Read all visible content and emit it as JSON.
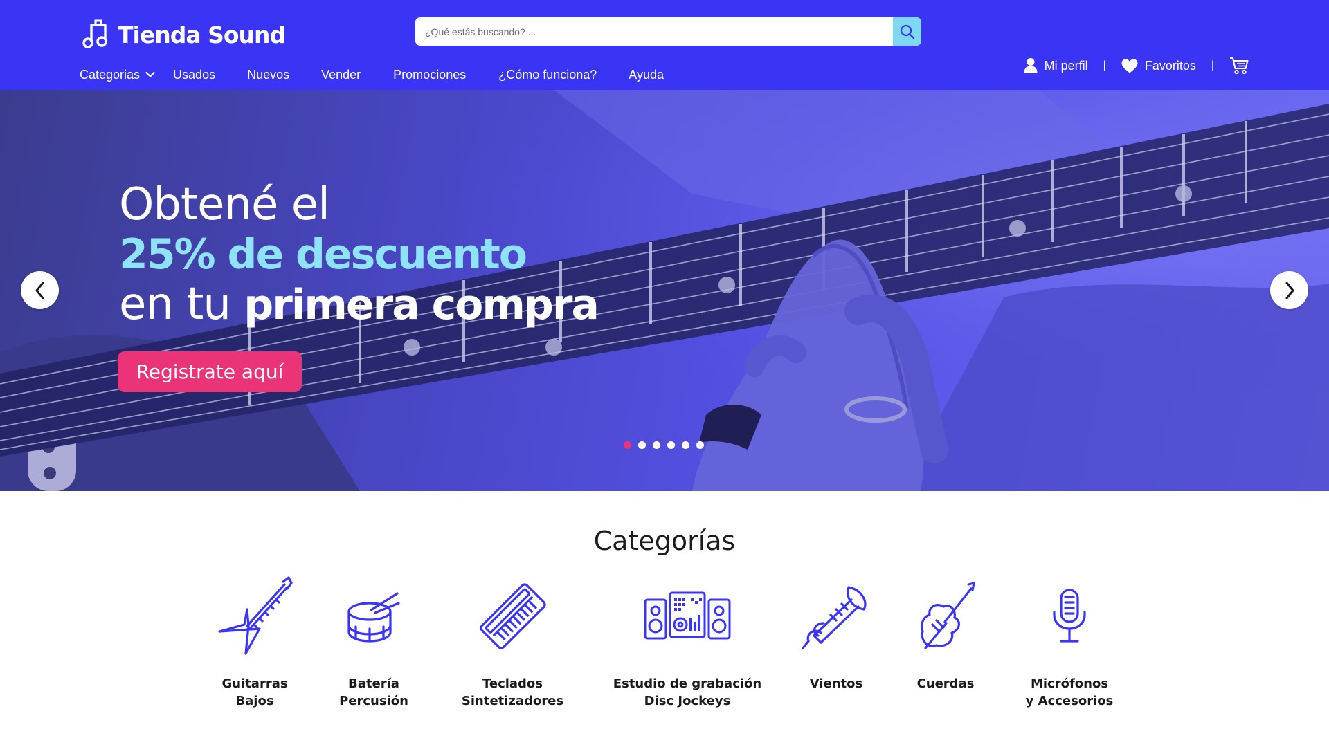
{
  "brand": {
    "name": "Tienda Sound",
    "logo_icon": "music-note-icon"
  },
  "search": {
    "placeholder": "¿Qué estás buscando? ...",
    "value": "",
    "icon": "search-icon"
  },
  "nav": {
    "items": [
      {
        "label": "Categorias",
        "has_dropdown": true
      },
      {
        "label": "Usados"
      },
      {
        "label": "Nuevos"
      },
      {
        "label": "Vender"
      },
      {
        "label": "Promociones"
      },
      {
        "label": "¿Cómo funciona?"
      },
      {
        "label": "Ayuda"
      }
    ]
  },
  "user_menu": {
    "profile_label": "Mi perfil",
    "favorites_label": "Favoritos",
    "separator": "|",
    "cart_icon": "shopping-cart-icon"
  },
  "hero": {
    "line1": "Obtené el",
    "line2": "25% de descuento",
    "line3_regular": "en tu ",
    "line3_bold": "primera compra",
    "cta_label": "Registrate aquí",
    "slides_total": 6,
    "active_slide": 1
  },
  "categories": {
    "title": "Categorías",
    "items": [
      {
        "line1": "Guitarras",
        "line2": "Bajos",
        "icon": "electric-guitar-icon"
      },
      {
        "line1": "Batería",
        "line2": "Percusión",
        "icon": "drum-icon"
      },
      {
        "line1": "Teclados",
        "line2": "Sintetizadores",
        "icon": "keyboard-synth-icon"
      },
      {
        "line1": "Estudio de grabación",
        "line2": "Disc Jockeys",
        "icon": "studio-speakers-icon"
      },
      {
        "line1": "Vientos",
        "line2": "",
        "icon": "trumpet-icon"
      },
      {
        "line1": "Cuerdas",
        "line2": "",
        "icon": "violin-icon"
      },
      {
        "line1": "Micrófonos",
        "line2": "y Accesorios",
        "icon": "microphone-icon"
      }
    ]
  },
  "colors": {
    "primary": "#3a34f4",
    "accent_cyan": "#8fe3f8",
    "accent_pink": "#eb3478",
    "icon_blue": "#3a34f4"
  }
}
